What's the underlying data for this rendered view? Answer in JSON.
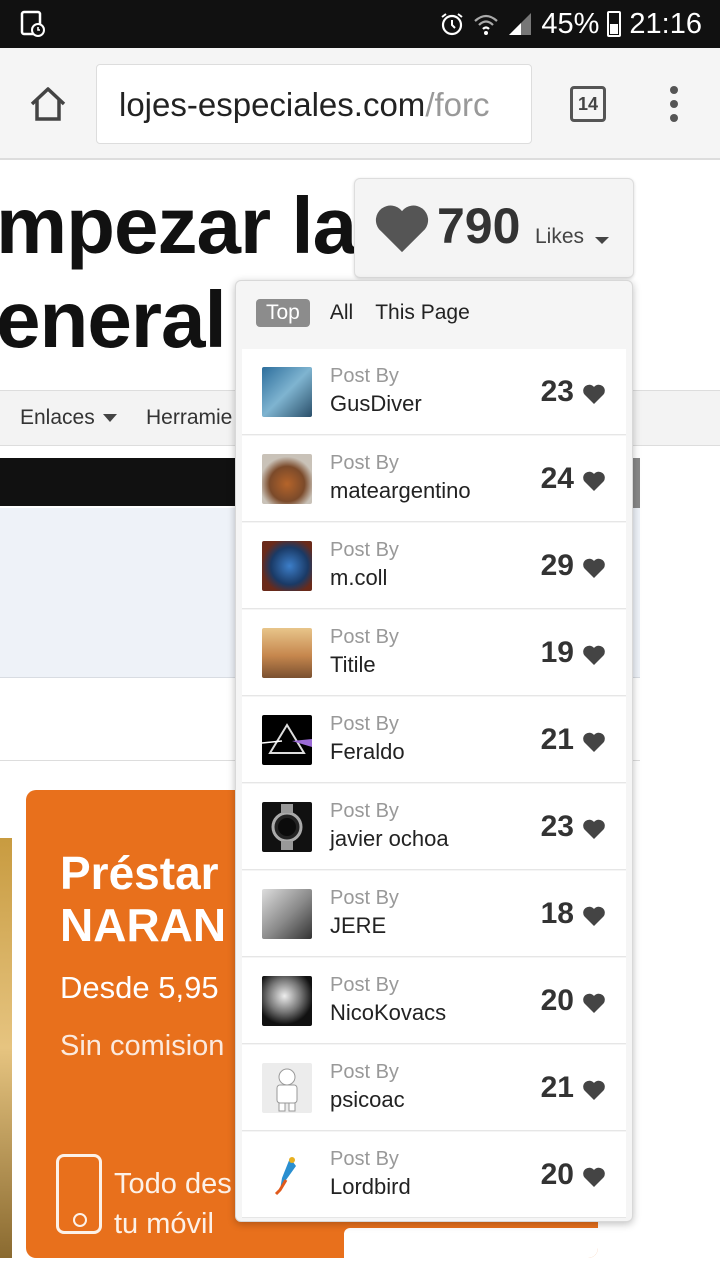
{
  "status_bar": {
    "battery": "45%",
    "time": "21:16",
    "icons": [
      "screenshot-icon",
      "alarm-icon",
      "wifi-icon",
      "signal-icon",
      "battery-icon"
    ]
  },
  "browser": {
    "url_host": "lojes-especiales.com",
    "url_path": "/forc",
    "tab_count": "14"
  },
  "page": {
    "heading_line1": "mpezar la",
    "heading_line2": "eneral",
    "nav": [
      "Enlaces",
      "Herramie"
    ],
    "ad": {
      "title1": "Préstar",
      "title2": "NARAN",
      "subtitle1": "Desde 5,95",
      "subtitle2": "Sin comision",
      "bottom1": "Todo des",
      "bottom2": "tu móvil",
      "color": "#e8701c"
    }
  },
  "likes": {
    "count": "790",
    "label": "Likes",
    "tabs": [
      "Top",
      "All",
      "This Page"
    ],
    "active_tab": "Top",
    "items": [
      {
        "post_by": "Post By",
        "user": "GusDiver",
        "count": "23"
      },
      {
        "post_by": "Post By",
        "user": "mateargentino",
        "count": "24"
      },
      {
        "post_by": "Post By",
        "user": "m.coll",
        "count": "29"
      },
      {
        "post_by": "Post By",
        "user": "Titile",
        "count": "19"
      },
      {
        "post_by": "Post By",
        "user": "Feraldo",
        "count": "21"
      },
      {
        "post_by": "Post By",
        "user": "javier ochoa",
        "count": "23"
      },
      {
        "post_by": "Post By",
        "user": "JERE",
        "count": "18"
      },
      {
        "post_by": "Post By",
        "user": "NicoKovacs",
        "count": "20"
      },
      {
        "post_by": "Post By",
        "user": "psicoac",
        "count": "21"
      },
      {
        "post_by": "Post By",
        "user": "Lordbird",
        "count": "20"
      }
    ]
  }
}
